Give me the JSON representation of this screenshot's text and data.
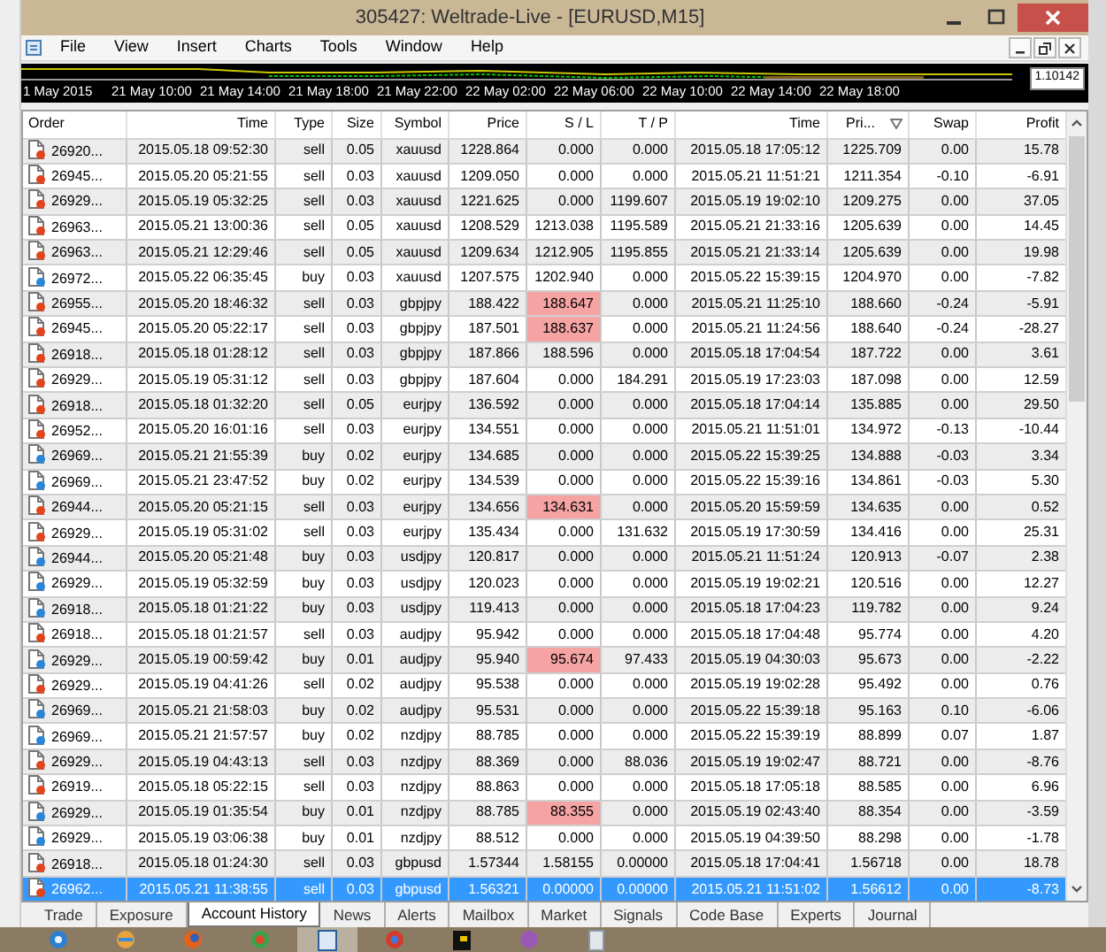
{
  "window": {
    "title": "305427: Weltrade-Live - [EURUSD,M15]"
  },
  "menu": [
    "File",
    "View",
    "Insert",
    "Charts",
    "Tools",
    "Window",
    "Help"
  ],
  "chart_strip": {
    "time_labels": [
      "1 May 2015",
      "21 May 10:00",
      "21 May 14:00",
      "21 May 18:00",
      "21 May 22:00",
      "22 May 02:00",
      "22 May 06:00",
      "22 May 10:00",
      "22 May 14:00",
      "22 May 18:00"
    ],
    "price_label": "1.10142"
  },
  "table": {
    "columns": [
      {
        "label": "Order",
        "sorted": false
      },
      {
        "label": "Time",
        "sorted": false
      },
      {
        "label": "Type",
        "sorted": false
      },
      {
        "label": "Size",
        "sorted": false
      },
      {
        "label": "Symbol",
        "sorted": false
      },
      {
        "label": "Price",
        "sorted": false
      },
      {
        "label": "S / L",
        "sorted": false
      },
      {
        "label": "T / P",
        "sorted": false
      },
      {
        "label": "Time",
        "sorted": false
      },
      {
        "label": "Pri...",
        "sorted": true
      },
      {
        "label": "Swap",
        "sorted": false
      },
      {
        "label": "Profit",
        "sorted": false
      }
    ],
    "rows": [
      {
        "cells": [
          "26920...",
          "2015.05.18 09:52:30",
          "sell",
          "0.05",
          "xauusd",
          "1228.864",
          "0.000",
          "0.000",
          "2015.05.18 17:05:12",
          "1225.709",
          "0.00",
          "15.78"
        ],
        "kind": "sell",
        "sl_hit": false,
        "selected": false
      },
      {
        "cells": [
          "26945...",
          "2015.05.20 05:21:55",
          "sell",
          "0.03",
          "xauusd",
          "1209.050",
          "0.000",
          "0.000",
          "2015.05.21 11:51:21",
          "1211.354",
          "-0.10",
          "-6.91"
        ],
        "kind": "sell",
        "sl_hit": false,
        "selected": false
      },
      {
        "cells": [
          "26929...",
          "2015.05.19 05:32:25",
          "sell",
          "0.03",
          "xauusd",
          "1221.625",
          "0.000",
          "1199.607",
          "2015.05.19 19:02:10",
          "1209.275",
          "0.00",
          "37.05"
        ],
        "kind": "sell",
        "sl_hit": false,
        "selected": false
      },
      {
        "cells": [
          "26963...",
          "2015.05.21 13:00:36",
          "sell",
          "0.05",
          "xauusd",
          "1208.529",
          "1213.038",
          "1195.589",
          "2015.05.21 21:33:16",
          "1205.639",
          "0.00",
          "14.45"
        ],
        "kind": "sell",
        "sl_hit": false,
        "selected": false
      },
      {
        "cells": [
          "26963...",
          "2015.05.21 12:29:46",
          "sell",
          "0.05",
          "xauusd",
          "1209.634",
          "1212.905",
          "1195.855",
          "2015.05.21 21:33:14",
          "1205.639",
          "0.00",
          "19.98"
        ],
        "kind": "sell",
        "sl_hit": false,
        "selected": false
      },
      {
        "cells": [
          "26972...",
          "2015.05.22 06:35:45",
          "buy",
          "0.03",
          "xauusd",
          "1207.575",
          "1202.940",
          "0.000",
          "2015.05.22 15:39:15",
          "1204.970",
          "0.00",
          "-7.82"
        ],
        "kind": "buy",
        "sl_hit": false,
        "selected": false
      },
      {
        "cells": [
          "26955...",
          "2015.05.20 18:46:32",
          "sell",
          "0.03",
          "gbpjpy",
          "188.422",
          "188.647",
          "0.000",
          "2015.05.21 11:25:10",
          "188.660",
          "-0.24",
          "-5.91"
        ],
        "kind": "sell",
        "sl_hit": true,
        "selected": false
      },
      {
        "cells": [
          "26945...",
          "2015.05.20 05:22:17",
          "sell",
          "0.03",
          "gbpjpy",
          "187.501",
          "188.637",
          "0.000",
          "2015.05.21 11:24:56",
          "188.640",
          "-0.24",
          "-28.27"
        ],
        "kind": "sell",
        "sl_hit": true,
        "selected": false
      },
      {
        "cells": [
          "26918...",
          "2015.05.18 01:28:12",
          "sell",
          "0.03",
          "gbpjpy",
          "187.866",
          "188.596",
          "0.000",
          "2015.05.18 17:04:54",
          "187.722",
          "0.00",
          "3.61"
        ],
        "kind": "sell",
        "sl_hit": false,
        "selected": false
      },
      {
        "cells": [
          "26929...",
          "2015.05.19 05:31:12",
          "sell",
          "0.03",
          "gbpjpy",
          "187.604",
          "0.000",
          "184.291",
          "2015.05.19 17:23:03",
          "187.098",
          "0.00",
          "12.59"
        ],
        "kind": "sell",
        "sl_hit": false,
        "selected": false
      },
      {
        "cells": [
          "26918...",
          "2015.05.18 01:32:20",
          "sell",
          "0.05",
          "eurjpy",
          "136.592",
          "0.000",
          "0.000",
          "2015.05.18 17:04:14",
          "135.885",
          "0.00",
          "29.50"
        ],
        "kind": "sell",
        "sl_hit": false,
        "selected": false
      },
      {
        "cells": [
          "26952...",
          "2015.05.20 16:01:16",
          "sell",
          "0.03",
          "eurjpy",
          "134.551",
          "0.000",
          "0.000",
          "2015.05.21 11:51:01",
          "134.972",
          "-0.13",
          "-10.44"
        ],
        "kind": "sell",
        "sl_hit": false,
        "selected": false
      },
      {
        "cells": [
          "26969...",
          "2015.05.21 21:55:39",
          "buy",
          "0.02",
          "eurjpy",
          "134.685",
          "0.000",
          "0.000",
          "2015.05.22 15:39:25",
          "134.888",
          "-0.03",
          "3.34"
        ],
        "kind": "buy",
        "sl_hit": false,
        "selected": false
      },
      {
        "cells": [
          "26969...",
          "2015.05.21 23:47:52",
          "buy",
          "0.02",
          "eurjpy",
          "134.539",
          "0.000",
          "0.000",
          "2015.05.22 15:39:16",
          "134.861",
          "-0.03",
          "5.30"
        ],
        "kind": "buy",
        "sl_hit": false,
        "selected": false
      },
      {
        "cells": [
          "26944...",
          "2015.05.20 05:21:15",
          "sell",
          "0.03",
          "eurjpy",
          "134.656",
          "134.631",
          "0.000",
          "2015.05.20 15:59:59",
          "134.635",
          "0.00",
          "0.52"
        ],
        "kind": "sell",
        "sl_hit": true,
        "selected": false
      },
      {
        "cells": [
          "26929...",
          "2015.05.19 05:31:02",
          "sell",
          "0.03",
          "eurjpy",
          "135.434",
          "0.000",
          "131.632",
          "2015.05.19 17:30:59",
          "134.416",
          "0.00",
          "25.31"
        ],
        "kind": "sell",
        "sl_hit": false,
        "selected": false
      },
      {
        "cells": [
          "26944...",
          "2015.05.20 05:21:48",
          "buy",
          "0.03",
          "usdjpy",
          "120.817",
          "0.000",
          "0.000",
          "2015.05.21 11:51:24",
          "120.913",
          "-0.07",
          "2.38"
        ],
        "kind": "buy",
        "sl_hit": false,
        "selected": false
      },
      {
        "cells": [
          "26929...",
          "2015.05.19 05:32:59",
          "buy",
          "0.03",
          "usdjpy",
          "120.023",
          "0.000",
          "0.000",
          "2015.05.19 19:02:21",
          "120.516",
          "0.00",
          "12.27"
        ],
        "kind": "buy",
        "sl_hit": false,
        "selected": false
      },
      {
        "cells": [
          "26918...",
          "2015.05.18 01:21:22",
          "buy",
          "0.03",
          "usdjpy",
          "119.413",
          "0.000",
          "0.000",
          "2015.05.18 17:04:23",
          "119.782",
          "0.00",
          "9.24"
        ],
        "kind": "buy",
        "sl_hit": false,
        "selected": false
      },
      {
        "cells": [
          "26918...",
          "2015.05.18 01:21:57",
          "sell",
          "0.03",
          "audjpy",
          "95.942",
          "0.000",
          "0.000",
          "2015.05.18 17:04:48",
          "95.774",
          "0.00",
          "4.20"
        ],
        "kind": "sell",
        "sl_hit": false,
        "selected": false
      },
      {
        "cells": [
          "26929...",
          "2015.05.19 00:59:42",
          "buy",
          "0.01",
          "audjpy",
          "95.940",
          "95.674",
          "97.433",
          "2015.05.19 04:30:03",
          "95.673",
          "0.00",
          "-2.22"
        ],
        "kind": "buy",
        "sl_hit": true,
        "selected": false
      },
      {
        "cells": [
          "26929...",
          "2015.05.19 04:41:26",
          "sell",
          "0.02",
          "audjpy",
          "95.538",
          "0.000",
          "0.000",
          "2015.05.19 19:02:28",
          "95.492",
          "0.00",
          "0.76"
        ],
        "kind": "sell",
        "sl_hit": false,
        "selected": false
      },
      {
        "cells": [
          "26969...",
          "2015.05.21 21:58:03",
          "buy",
          "0.02",
          "audjpy",
          "95.531",
          "0.000",
          "0.000",
          "2015.05.22 15:39:18",
          "95.163",
          "0.10",
          "-6.06"
        ],
        "kind": "buy",
        "sl_hit": false,
        "selected": false
      },
      {
        "cells": [
          "26969...",
          "2015.05.21 21:57:57",
          "buy",
          "0.02",
          "nzdjpy",
          "88.785",
          "0.000",
          "0.000",
          "2015.05.22 15:39:19",
          "88.899",
          "0.07",
          "1.87"
        ],
        "kind": "buy",
        "sl_hit": false,
        "selected": false
      },
      {
        "cells": [
          "26929...",
          "2015.05.19 04:43:13",
          "sell",
          "0.03",
          "nzdjpy",
          "88.369",
          "0.000",
          "88.036",
          "2015.05.19 19:02:47",
          "88.721",
          "0.00",
          "-8.76"
        ],
        "kind": "sell",
        "sl_hit": false,
        "selected": false
      },
      {
        "cells": [
          "26919...",
          "2015.05.18 05:22:15",
          "sell",
          "0.03",
          "nzdjpy",
          "88.863",
          "0.000",
          "0.000",
          "2015.05.18 17:05:18",
          "88.585",
          "0.00",
          "6.96"
        ],
        "kind": "sell",
        "sl_hit": false,
        "selected": false
      },
      {
        "cells": [
          "26929...",
          "2015.05.19 01:35:54",
          "buy",
          "0.01",
          "nzdjpy",
          "88.785",
          "88.355",
          "0.000",
          "2015.05.19 02:43:40",
          "88.354",
          "0.00",
          "-3.59"
        ],
        "kind": "buy",
        "sl_hit": true,
        "selected": false
      },
      {
        "cells": [
          "26929...",
          "2015.05.19 03:06:38",
          "buy",
          "0.01",
          "nzdjpy",
          "88.512",
          "0.000",
          "0.000",
          "2015.05.19 04:39:50",
          "88.298",
          "0.00",
          "-1.78"
        ],
        "kind": "buy",
        "sl_hit": false,
        "selected": false
      },
      {
        "cells": [
          "26918...",
          "2015.05.18 01:24:30",
          "sell",
          "0.03",
          "gbpusd",
          "1.57344",
          "1.58155",
          "0.00000",
          "2015.05.18 17:04:41",
          "1.56718",
          "0.00",
          "18.78"
        ],
        "kind": "sell",
        "sl_hit": false,
        "selected": false
      },
      {
        "cells": [
          "26962...",
          "2015.05.21 11:38:55",
          "sell",
          "0.03",
          "gbpusd",
          "1.56321",
          "0.00000",
          "0.00000",
          "2015.05.21 11:51:02",
          "1.56612",
          "0.00",
          "-8.73"
        ],
        "kind": "sell",
        "sl_hit": false,
        "selected": true
      }
    ]
  },
  "tabs": [
    {
      "label": "Trade",
      "selected": false
    },
    {
      "label": "Exposure",
      "selected": false
    },
    {
      "label": "Account History",
      "selected": true
    },
    {
      "label": "News",
      "selected": false
    },
    {
      "label": "Alerts",
      "selected": false
    },
    {
      "label": "Mailbox",
      "selected": false
    },
    {
      "label": "Market",
      "selected": false
    },
    {
      "label": "Signals",
      "selected": false
    },
    {
      "label": "Code Base",
      "selected": false
    },
    {
      "label": "Experts",
      "selected": false
    },
    {
      "label": "Journal",
      "selected": false
    }
  ],
  "taskbar": [
    {
      "selected": false
    },
    {
      "selected": false
    },
    {
      "selected": false
    },
    {
      "selected": false
    },
    {
      "selected": true
    },
    {
      "selected": false
    },
    {
      "selected": false
    },
    {
      "selected": false
    },
    {
      "selected": false
    }
  ]
}
